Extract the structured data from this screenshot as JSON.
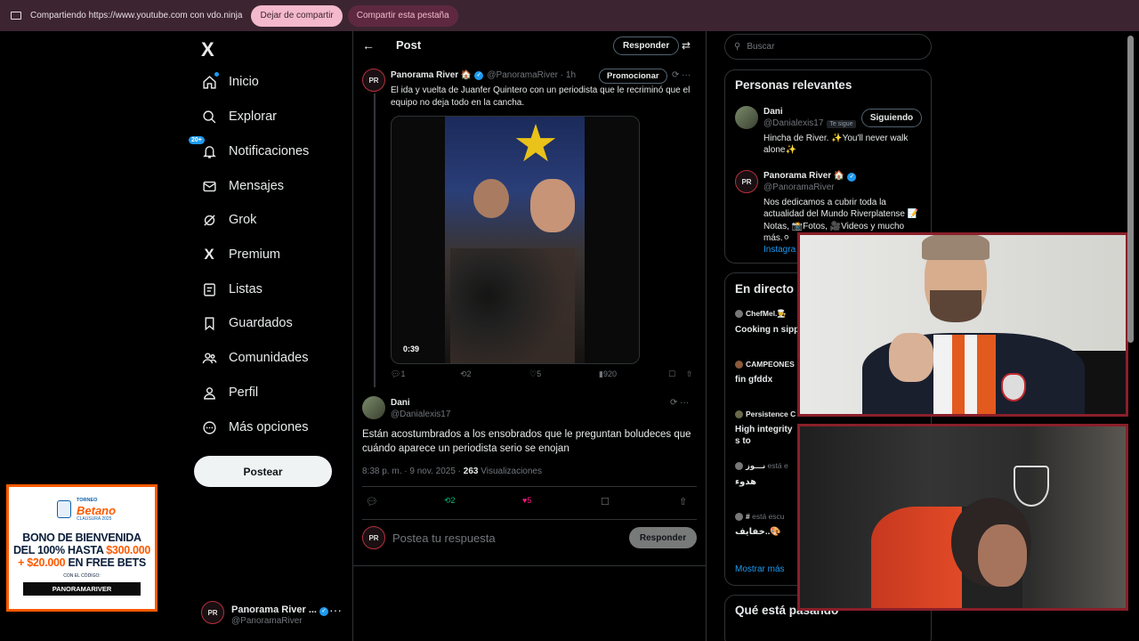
{
  "sharebar": {
    "message": "Compartiendo https://www.youtube.com con vdo.ninja",
    "stop_label": "Dejar de compartir",
    "share_tab_label": "Compartir esta pestaña"
  },
  "nav": {
    "logo": "X",
    "items": [
      {
        "label": "Inicio",
        "icon": "home-icon"
      },
      {
        "label": "Explorar",
        "icon": "search-icon"
      },
      {
        "label": "Notificaciones",
        "icon": "bell-icon",
        "badge": "20+"
      },
      {
        "label": "Mensajes",
        "icon": "mail-icon"
      },
      {
        "label": "Grok",
        "icon": "grok-icon"
      },
      {
        "label": "Premium",
        "icon": "x-icon"
      },
      {
        "label": "Listas",
        "icon": "list-icon"
      },
      {
        "label": "Guardados",
        "icon": "bookmark-icon"
      },
      {
        "label": "Comunidades",
        "icon": "people-icon"
      },
      {
        "label": "Perfil",
        "icon": "person-icon"
      },
      {
        "label": "Más opciones",
        "icon": "more-circle-icon"
      }
    ],
    "post_label": "Postear",
    "account": {
      "name": "Panorama River ...",
      "handle": "@PanoramaRiver"
    }
  },
  "header": {
    "title": "Post",
    "reply_label": "Responder"
  },
  "quoted_post": {
    "avatar_text": "PR",
    "name": "Panorama River 🏠",
    "handle": "@PanoramaRiver · 1h",
    "promote_label": "Promocionar",
    "text": "El ida y vuelta de Juanfer Quintero con un periodista que le recriminó que el equipo no deja todo en la cancha.",
    "video_time": "0:39",
    "replies": "1",
    "reposts": "2",
    "likes": "5",
    "views": "920"
  },
  "main_post": {
    "name": "Dani",
    "handle": "@Danialexis17",
    "text": "Están acostumbrados a los ensobrados que le preguntan boludeces que cuándo aparece un periodista serio se enojan",
    "time": "8:38 p. m. · 9 nov. 2025 · ",
    "views_count": "263",
    "views_label": " Visualizaciones",
    "reposts": "2",
    "likes": "5"
  },
  "composer": {
    "placeholder": "Postea tu respuesta",
    "button": "Responder"
  },
  "search": {
    "placeholder": "Buscar"
  },
  "relevant": {
    "title": "Personas relevantes",
    "people": [
      {
        "name": "Dani",
        "handle": "@Danialexis17",
        "follows_you": "Te sigue",
        "bio": "Hincha de River. ✨You'll never walk alone✨",
        "button": "Siguiendo"
      },
      {
        "name": "Panorama River 🏠",
        "handle": "@PanoramaRiver",
        "bio": "Nos dedicamos a cubrir toda la actualidad del Mundo Riverplatense 📝Notas, 📸Fotos, 🎥Videos y mucho más.⚪",
        "link": "Instagra"
      }
    ]
  },
  "live": {
    "title": "En directo",
    "items": [
      {
        "who": "ChefMel.👨‍🍳",
        "status": "",
        "title": "Cooking n sipp"
      },
      {
        "who": "CAMPEONES",
        "status": "",
        "title": "fin gfddx"
      },
      {
        "who": "Persistence C",
        "status": "",
        "title": "High integrity s to"
      },
      {
        "who": "نـــوز",
        "status": "está e",
        "title": "هدوء"
      },
      {
        "who": "#",
        "status": "está escu",
        "title": "خفايف..🎨"
      }
    ],
    "show_more": "Mostrar más"
  },
  "trending": {
    "title": "Qué está pasando"
  },
  "ad": {
    "torneo": "TORNEO",
    "brand": "Betano",
    "year": "CLAUSURA 2025",
    "line1": "BONO DE BIENVENIDA",
    "line2a": "DEL 100% HASTA ",
    "line2b": "$300.000",
    "line3a": "+ $20.000",
    "line3b": " EN FREE BETS",
    "line4": "CON EL CÓDIGO:",
    "code": "PANORAMARIVER"
  },
  "colors": {
    "accent": "#1d9bf0",
    "like": "#f91880",
    "repost": "#00ba7c",
    "sharebar": "#3c2531",
    "webcam_border": "#8a1f2a"
  }
}
